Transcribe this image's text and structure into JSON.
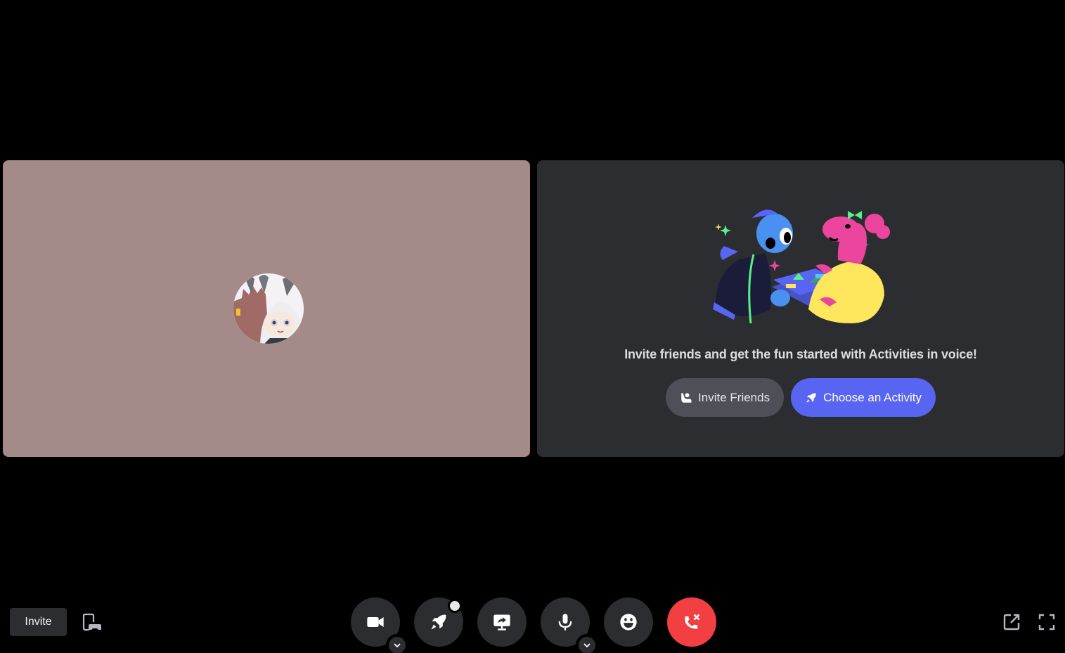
{
  "tiles": {
    "user_tile": {
      "name": "user-video-tile",
      "background": "#a58a8a",
      "avatar": "user-avatar"
    },
    "activity_tile": {
      "promo_text": "Invite friends and get the fun started with Activities in voice!",
      "buttons": [
        {
          "label": "Invite Friends",
          "icon": "add-friend-icon"
        },
        {
          "label": "Choose an Activity",
          "icon": "rocket-icon"
        }
      ]
    }
  },
  "bottom_bar": {
    "invite_label": "Invite",
    "device_icon": "switch-device-icon",
    "controls": [
      {
        "name": "camera",
        "icon": "video-camera-icon",
        "has_options": true
      },
      {
        "name": "activity",
        "icon": "rocket-icon",
        "has_badge": true
      },
      {
        "name": "share-screen",
        "icon": "screen-share-icon"
      },
      {
        "name": "microphone",
        "icon": "microphone-icon",
        "has_options": true
      },
      {
        "name": "soundboard",
        "icon": "smiley-icon"
      },
      {
        "name": "disconnect",
        "icon": "hang-up-icon"
      }
    ],
    "right_icons": [
      "pop-out-icon",
      "fullscreen-icon"
    ]
  },
  "colors": {
    "background": "#000000",
    "tile_dark": "#2b2d31",
    "blurple": "#5865f2",
    "danger": "#f23f42",
    "grey_button": "#4e5058"
  }
}
